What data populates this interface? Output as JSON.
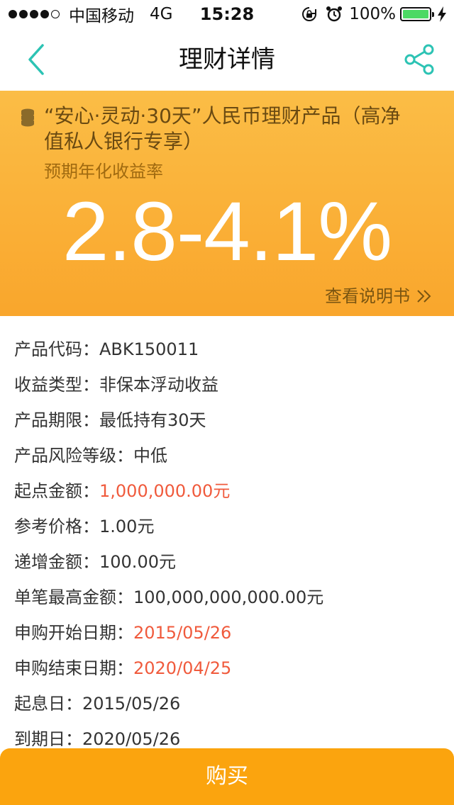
{
  "status_bar": {
    "carrier": "中国移动",
    "network": "4G",
    "time": "15:28",
    "battery": "100%"
  },
  "nav": {
    "title": "理财详情"
  },
  "hero": {
    "product_title": "“安心·灵动·30天”人民币理财产品（高净值私人银行专享）",
    "rate_label": "预期年化收益率",
    "rate_value": "2.8-4.1%",
    "manual_link": "查看说明书"
  },
  "details": {
    "product_code": {
      "label": "产品代码：",
      "value": "ABK150011"
    },
    "income_type": {
      "label": "收益类型：",
      "value": "非保本浮动收益"
    },
    "term": {
      "label": "产品期限：",
      "value": "最低持有30天"
    },
    "risk_level": {
      "label": "产品风险等级：",
      "value": "中低"
    },
    "min_amount": {
      "label": "起点金额：",
      "value": "1,000,000.00元"
    },
    "ref_price": {
      "label": "参考价格：",
      "value": "1.00元"
    },
    "increment": {
      "label": "递增金额：",
      "value": "100.00元"
    },
    "max_single": {
      "label": "单笔最高金额：",
      "value": "100,000,000,000.00元"
    },
    "sub_start": {
      "label": "申购开始日期：",
      "value": "2015/05/26"
    },
    "sub_end": {
      "label": "申购结束日期：",
      "value": "2020/04/25"
    },
    "value_date": {
      "label": "起息日：",
      "value": "2015/05/26"
    },
    "maturity_date": {
      "label": "到期日：",
      "value": "2020/05/26"
    }
  },
  "buy_button": {
    "label": "购买"
  },
  "colors": {
    "accent_teal": "#2cc3b4",
    "hero_orange": "#f9a62c",
    "button_orange": "#fba40e",
    "highlight_red": "#f05a3c"
  },
  "icons": {
    "back": "chevron-left-icon",
    "share": "share-icon",
    "product": "coins-icon",
    "more": "double-chevron-right-icon"
  }
}
